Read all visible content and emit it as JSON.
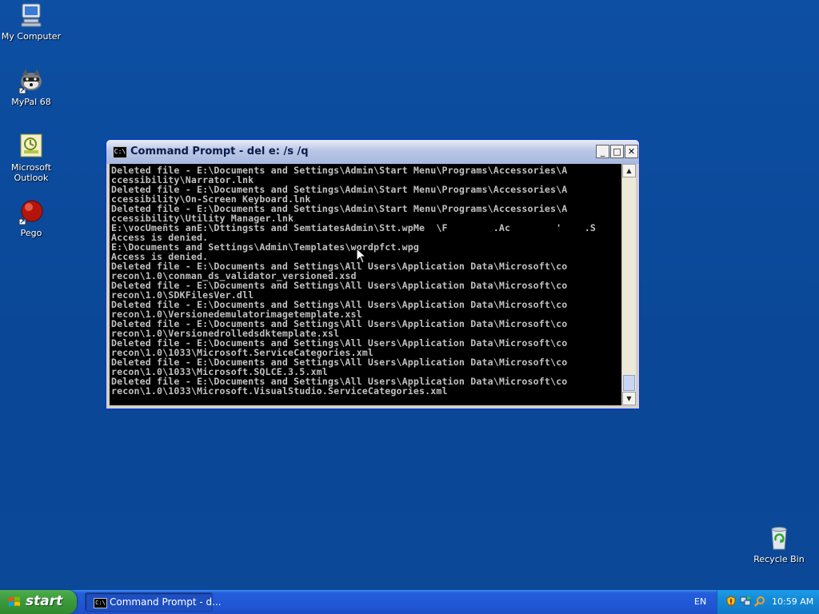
{
  "desktop": {
    "icons": [
      {
        "label": "My Computer"
      },
      {
        "label": "MyPal 68"
      },
      {
        "label": "Microsoft Outlook"
      },
      {
        "label": "Pego"
      },
      {
        "label": "Recycle Bin"
      }
    ]
  },
  "window": {
    "title": "Command Prompt - del e: /s /q",
    "icon_text": "C:\\",
    "minimize_label": "_",
    "maximize_label": "□",
    "close_label": "✕",
    "console_text": "Deleted file - E:\\Documents and Settings\\Admin\\Start Menu\\Programs\\Accessories\\A\nccessibility\\Narrator.lnk\nDeleted file - E:\\Documents and Settings\\Admin\\Start Menu\\Programs\\Accessories\\A\nccessibility\\On-Screen Keyboard.lnk\nDeleted file - E:\\Documents and Settings\\Admin\\Start Menu\\Programs\\Accessories\\A\nccessibility\\Utility Manager.lnk\nE:\\vocUmeñts anE:\\Dttingsts and SemtiatesAdmin\\Stt.wpMe  \\F        .Ac        '    .S\nAccess is denied.\nE:\\Documents and Settings\\Admin\\Templates\\wordpfct.wpg\nAccess is denied.\nDeleted file - E:\\Documents and Settings\\All Users\\Application Data\\Microsoft\\co\nrecon\\1.0\\conman_ds_validator_versioned.xsd\nDeleted file - E:\\Documents and Settings\\All Users\\Application Data\\Microsoft\\co\nrecon\\1.0\\SDKFilesVer.dll\nDeleted file - E:\\Documents and Settings\\All Users\\Application Data\\Microsoft\\co\nrecon\\1.0\\Versionedemulatorimagetemplate.xsl\nDeleted file - E:\\Documents and Settings\\All Users\\Application Data\\Microsoft\\co\nrecon\\1.0\\Versionedrolledsdktemplate.xsl\nDeleted file - E:\\Documents and Settings\\All Users\\Application Data\\Microsoft\\co\nrecon\\1.0\\1033\\Microsoft.ServiceCategories.xml\nDeleted file - E:\\Documents and Settings\\All Users\\Application Data\\Microsoft\\co\nrecon\\1.0\\1033\\Microsoft.SQLCE.3.5.xml\nDeleted file - E:\\Documents and Settings\\All Users\\Application Data\\Microsoft\\co\nrecon\\1.0\\1033\\Microsoft.VisualStudio.ServiceCategories.xml",
    "scroll_up": "▲",
    "scroll_down": "▼"
  },
  "taskbar": {
    "start_label": "start",
    "task_button_label": "Command Prompt - d...",
    "task_icon_text": "C:\\",
    "language": "EN",
    "clock": "10:59 AM"
  },
  "colors": {
    "desktop": "#0a4a9c",
    "taskbar": "#245edb",
    "start": "#3c9a3c",
    "tray": "#148ad9",
    "console_bg": "#000000",
    "console_fg": "#c0c0c0"
  }
}
